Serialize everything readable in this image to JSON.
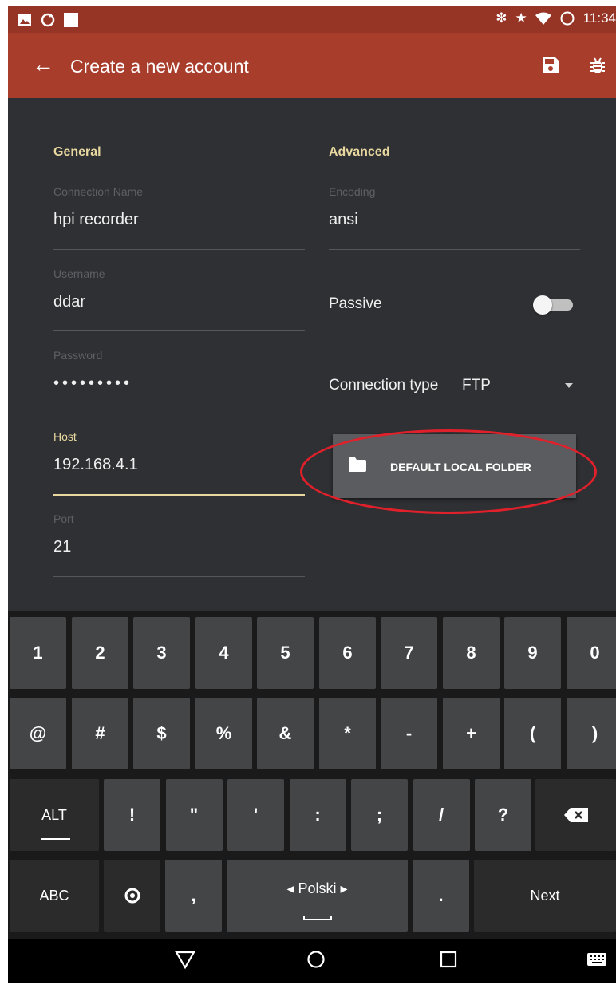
{
  "status_bar": {
    "time": "11:34"
  },
  "app_bar": {
    "title": "Create a new account"
  },
  "general": {
    "heading": "General",
    "fields": {
      "connection_name": {
        "label": "Connection Name",
        "value": "hpi recorder"
      },
      "username": {
        "label": "Username",
        "value": "ddar"
      },
      "password": {
        "label": "Password",
        "value": "•••••••••"
      },
      "host": {
        "label": "Host",
        "value": "192.168.4.1"
      },
      "port": {
        "label": "Port",
        "value": "21"
      }
    }
  },
  "advanced": {
    "heading": "Advanced",
    "encoding": {
      "label": "Encoding",
      "value": "ansi"
    },
    "passive": {
      "label": "Passive",
      "enabled": false
    },
    "connection_type": {
      "label": "Connection type",
      "value": "FTP"
    },
    "folder_button": {
      "label": "DEFAULT LOCAL FOLDER"
    }
  },
  "keyboard": {
    "row1": [
      "1",
      "2",
      "3",
      "4",
      "5",
      "6",
      "7",
      "8",
      "9",
      "0"
    ],
    "row2": [
      "@",
      "#",
      "$",
      "%",
      "&",
      "*",
      "-",
      "+",
      "(",
      ")"
    ],
    "row3": {
      "alt": "ALT",
      "keys": [
        "!",
        "\"",
        "'",
        ":",
        ";",
        "/",
        "?"
      ]
    },
    "row4": {
      "abc": "ABC",
      "comma": ",",
      "space": "◂ Polski ▸",
      "period": ".",
      "next": "Next"
    }
  },
  "colors": {
    "app_bar": "#a93d2c",
    "status_bar": "#963526",
    "accent": "#e8d8a0",
    "highlight": "#e0202a"
  }
}
